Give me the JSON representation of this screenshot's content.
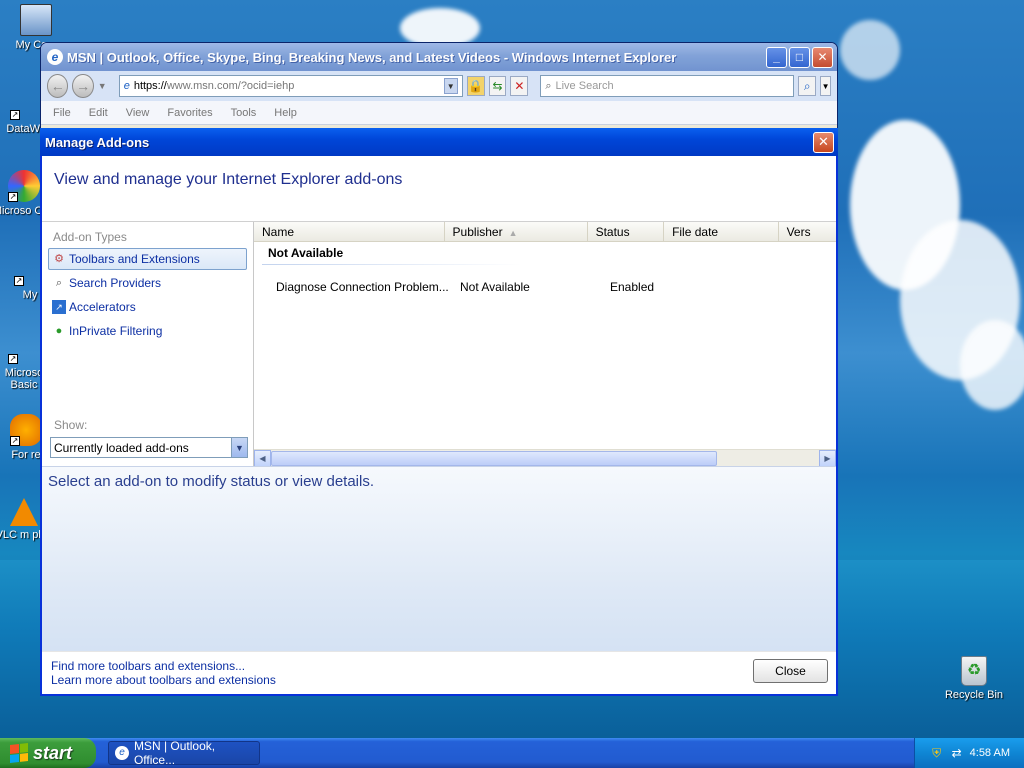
{
  "desktop": {
    "icons": [
      {
        "label": "My Com",
        "name": "my-computer"
      },
      {
        "label": "DataWa",
        "name": "datawarehouse"
      },
      {
        "label": "Microso C++",
        "name": "microsoft-cpp"
      },
      {
        "label": "My",
        "name": "my-documents"
      },
      {
        "label": "Microso Basic",
        "name": "microsoft-basic"
      },
      {
        "label": "For re",
        "name": "for-re"
      },
      {
        "label": "VLC m play",
        "name": "vlc-player"
      }
    ],
    "recycle_bin": "Recycle Bin"
  },
  "ie": {
    "title": "MSN | Outlook, Office, Skype, Bing, Breaking News, and Latest Videos - Windows Internet Explorer",
    "url_prefix": "https://",
    "url_rest": "www.msn.com/?ocid=iehp",
    "search_placeholder": "Live Search",
    "menu": [
      "File",
      "Edit",
      "View",
      "Favorites",
      "Tools",
      "Help"
    ]
  },
  "dialog": {
    "title": "Manage Add-ons",
    "header": "View and manage your Internet Explorer add-ons",
    "addon_types_label": "Add-on Types",
    "addon_types": [
      {
        "label": "Toolbars and Extensions",
        "icon": "gear-icon",
        "selected": true
      },
      {
        "label": "Search Providers",
        "icon": "search-icon",
        "selected": false
      },
      {
        "label": "Accelerators",
        "icon": "accelerator-icon",
        "selected": false
      },
      {
        "label": "InPrivate Filtering",
        "icon": "inprivate-icon",
        "selected": false
      }
    ],
    "show_label": "Show:",
    "show_value": "Currently loaded add-ons",
    "columns": [
      "Name",
      "Publisher",
      "Status",
      "File date",
      "Vers"
    ],
    "group": "Not Available",
    "rows": [
      {
        "name": "Diagnose Connection Problem...",
        "publisher": "Not Available",
        "status": "Enabled"
      }
    ],
    "details_text": "Select an add-on to modify status or view details.",
    "link_find": "Find more toolbars and extensions...",
    "link_learn": "Learn more about toolbars and extensions",
    "close_label": "Close"
  },
  "taskbar": {
    "start": "start",
    "task_label": "MSN | Outlook, Office...",
    "clock": "4:58 AM"
  },
  "colors": {
    "dialog_title": "#0046d8",
    "link": "#0c2fa3",
    "header_text": "#1f2f8f"
  }
}
